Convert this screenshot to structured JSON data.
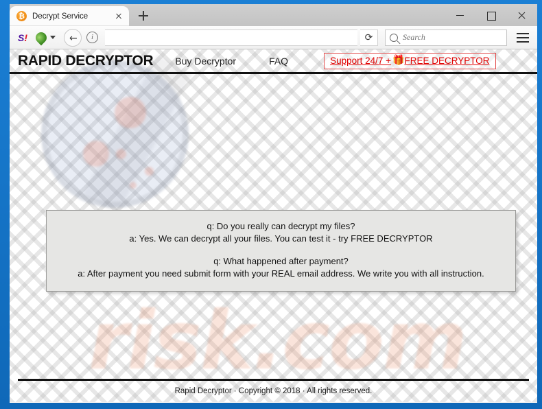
{
  "browser": {
    "tab": {
      "title": "Decrypt Service",
      "favicon": "bitcoin-favicon",
      "favicon_glyph": "₿",
      "favicon_color": "#ee8b14",
      "close_icon": "close-icon"
    },
    "new_tab_icon": "plus-icon",
    "window_controls": {
      "minimize": "minimize-icon",
      "maximize": "maximize-icon",
      "close": "close-icon"
    },
    "toolbar": {
      "yahoo_icon_s": "S",
      "yahoo_icon_ex": "!",
      "globe_icon": "globe-icon",
      "globe_caret": "chevron-down-icon",
      "back_icon": "←",
      "info_icon": "i",
      "url_value": "",
      "reload_icon": "⟳",
      "search_icon": "search-icon",
      "search_placeholder": "Search",
      "search_value": "",
      "menu_icon": "hamburger-menu-icon"
    }
  },
  "site": {
    "title": "RAPID DECRYPTOR",
    "nav": [
      {
        "label": "Buy Decryptor"
      },
      {
        "label": "FAQ"
      }
    ],
    "support_badge": {
      "text_before": "Support 24/7 + ",
      "gift_icon": "🎁",
      "text_after": "FREE DECRYPTOR",
      "color": "#e00000",
      "border_color": "#e24a4a"
    },
    "content": {
      "lines": [
        "q: Do you really can decrypt my files?",
        "a: Yes. We can decrypt all your files. You can test it - try FREE DECRYPTOR",
        "",
        "q: What happened after payment?",
        "a: After payment you need submit form with your REAL email address. We write you with all instruction."
      ],
      "background": "#e6e6e4"
    },
    "watermark": {
      "text": "risk.com",
      "glass_icon": "magnifying-glass-watermark"
    },
    "footer": {
      "text": "Rapid Decryptor · Copyright © 2018 · All rights reserved."
    }
  }
}
